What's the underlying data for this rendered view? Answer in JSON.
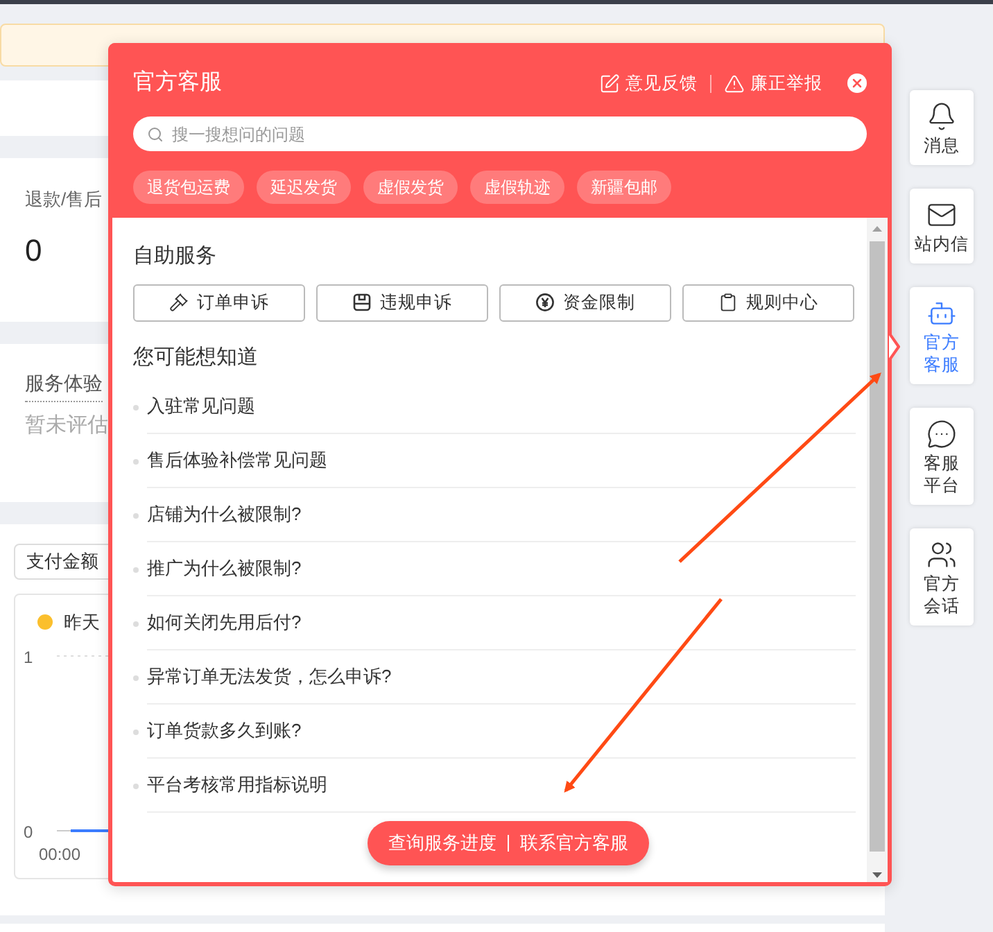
{
  "refund_card": {
    "label": "退款/售后",
    "value": "0"
  },
  "service_card": {
    "label": "服务体验",
    "status": "暂未评估"
  },
  "trend_card": {
    "metric_select": "支付金额",
    "legend": [
      {
        "label": "昨天",
        "color": "#fbbf2d"
      }
    ],
    "y_ticks": [
      "1",
      "0"
    ],
    "x_ticks": [
      "00:00"
    ]
  },
  "popup": {
    "title": "官方客服",
    "header_links": [
      {
        "label": "意见反馈",
        "kind": "feedback"
      },
      {
        "label": "廉正举报",
        "kind": "report"
      }
    ],
    "search": {
      "placeholder": "搜一搜想问的问题"
    },
    "tags": [
      "退货包运费",
      "延迟发货",
      "虚假发货",
      "虚假轨迹",
      "新疆包邮"
    ],
    "self_service": {
      "title": "自助服务",
      "buttons": [
        {
          "label": "订单申诉",
          "kind": "hammer"
        },
        {
          "label": "违规申诉",
          "kind": "badge"
        },
        {
          "label": "资金限制",
          "kind": "yen"
        },
        {
          "label": "规则中心",
          "kind": "clipboard"
        }
      ]
    },
    "faq": {
      "title": "您可能想知道",
      "items": [
        "入驻常见问题",
        "售后体验补偿常见问题",
        "店铺为什么被限制?",
        "推广为什么被限制?",
        "如何关闭先用后付?",
        "异常订单无法发货，怎么申诉?",
        "订单货款多久到账?",
        "平台考核常用指标说明"
      ]
    },
    "footer_actions": [
      "查询服务进度",
      "联系官方客服"
    ]
  },
  "sidebar": {
    "items": [
      {
        "label": "消息",
        "kind": "bell",
        "selected": false
      },
      {
        "label": "站内信",
        "kind": "mail",
        "selected": false
      },
      {
        "label": "官方客服",
        "kind": "bot",
        "selected": true
      },
      {
        "label": "客服平台",
        "kind": "chat",
        "selected": false
      },
      {
        "label": "官方会话",
        "kind": "users",
        "selected": false
      }
    ]
  }
}
